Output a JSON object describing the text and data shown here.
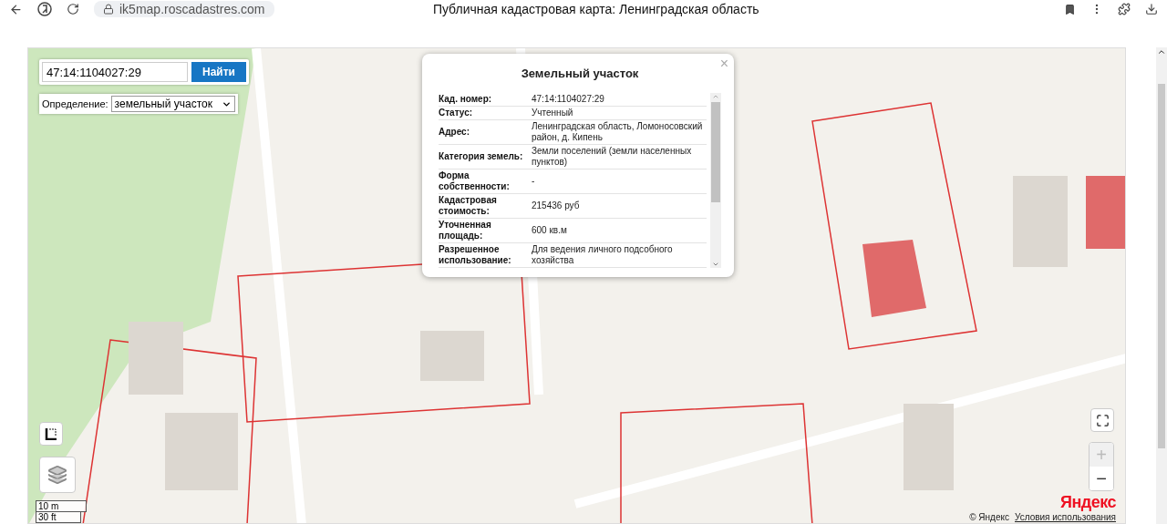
{
  "browser": {
    "url": "ik5map.roscadastres.com",
    "title": "Публичная кадастровая карта: Ленинградская область"
  },
  "search": {
    "value": "47:14:1104027:29",
    "button": "Найти"
  },
  "definition": {
    "label": "Определение:",
    "value": "земельный участок"
  },
  "popup": {
    "title": "Земельный участок",
    "close": "×",
    "rows": [
      {
        "label": "Кад. номер:",
        "value": "47:14:1104027:29"
      },
      {
        "label": "Статус:",
        "value": "Учтенный"
      },
      {
        "label": "Адрес:",
        "value": "Ленинградская область, Ломоносовский район, д. Кипень"
      },
      {
        "label": "Категория земель:",
        "value": "Земли поселений (земли населенных пунктов)"
      },
      {
        "label": "Форма собственности:",
        "value": "-"
      },
      {
        "label": "Кадастровая стоимость:",
        "value": "215436 руб"
      },
      {
        "label": "Уточненная площадь:",
        "value": "600 кв.м"
      },
      {
        "label": "Разрешенное использование:",
        "value": "Для ведения личного подсобного хозяйства"
      }
    ]
  },
  "zoom": [
    {
      "label": "+",
      "disabled": true
    },
    {
      "label": "−",
      "disabled": false
    }
  ],
  "scale": [
    "10 m",
    "30 ft"
  ],
  "attribution": {
    "logo": "Яндекс",
    "copyright": "© Яндекс",
    "link": "Условия использования"
  }
}
